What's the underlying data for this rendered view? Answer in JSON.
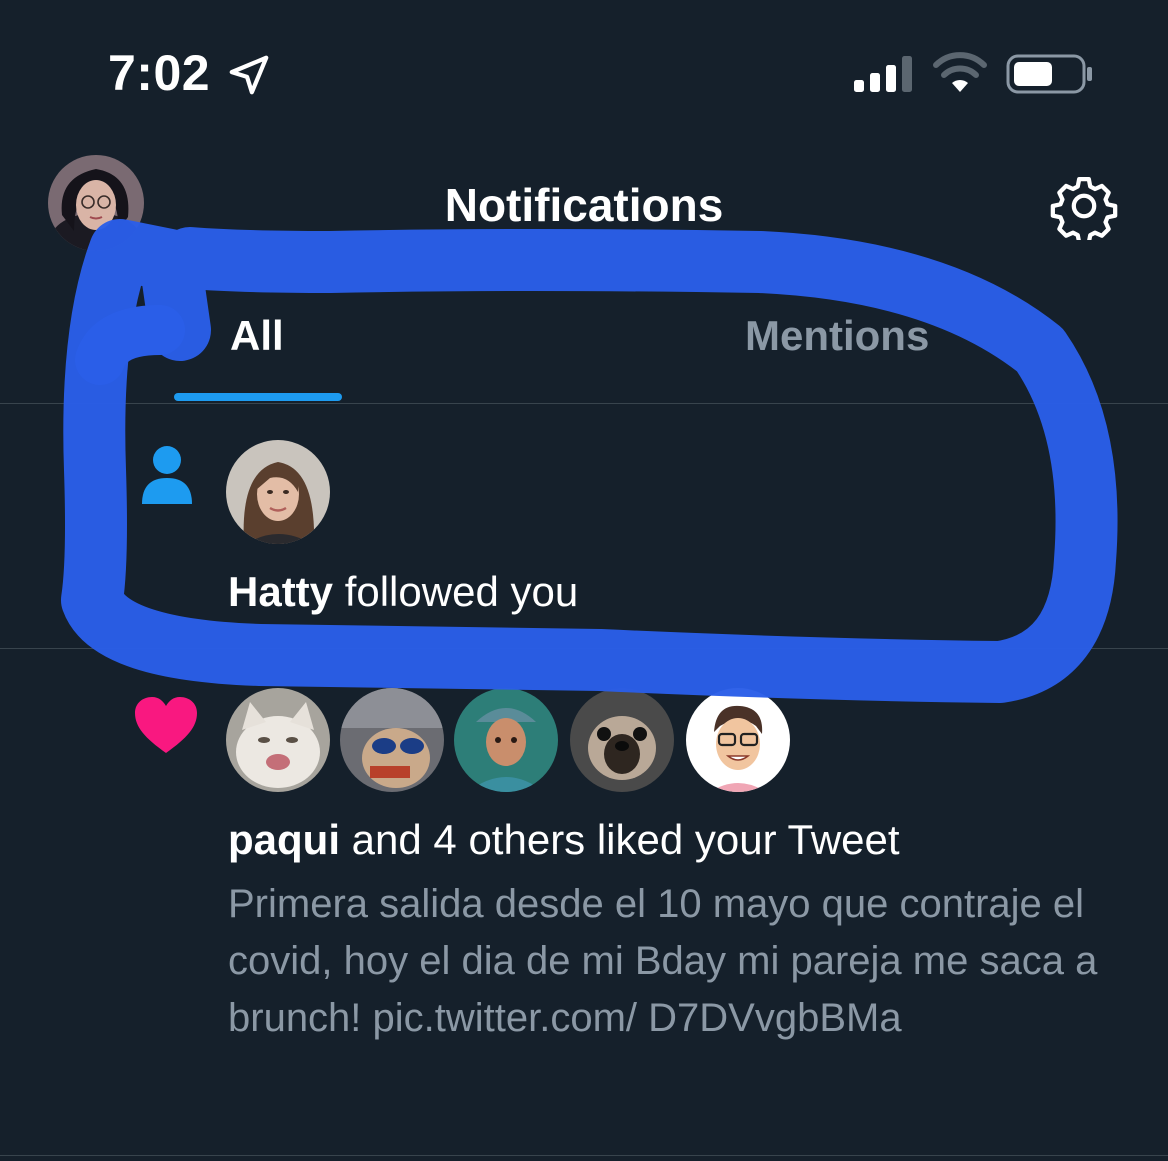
{
  "status_bar": {
    "time": "7:02",
    "icons": [
      "location-arrow-icon",
      "cellular-signal-icon",
      "wifi-icon",
      "battery-icon"
    ]
  },
  "header": {
    "title": "Notifications",
    "settings_icon": "gear-icon"
  },
  "tabs": [
    {
      "label": "All",
      "selected": true
    },
    {
      "label": "Mentions",
      "selected": false
    }
  ],
  "notifications": [
    {
      "type": "follow",
      "icon": "person-icon",
      "name": "Hatty",
      "action": "followed you"
    },
    {
      "type": "like",
      "icon": "heart-icon",
      "name": "paqui",
      "action": "and 4 others liked your Tweet",
      "tweet_text": "Primera salida desde el 10 mayo que contraje el covid, hoy el dia de mi Bday mi pareja me saca a brunch! pic.twitter.com/ D7DVvgbBMa",
      "liker_avatars": [
        "cat-avatar",
        "sunglasses-avatar",
        "character-avatar",
        "dog-avatar",
        "bitmoji-avatar"
      ]
    }
  ],
  "colors": {
    "background": "#15202b",
    "accent": "#1d9bf0",
    "like": "#f91880",
    "secondary_text": "#8b98a5",
    "divider": "#38444d",
    "marker": "#2a5ee8"
  }
}
